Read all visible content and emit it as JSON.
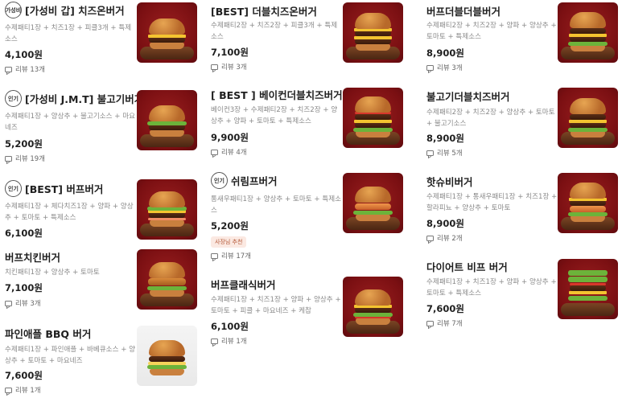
{
  "review_prefix": "리뷰",
  "columns": [
    {
      "items": [
        {
          "badge": "가성비",
          "name": "[가성비 갑] 치즈온버거",
          "desc": [
            "수제패티1장 + 치즈1장 + 피클3개 + 특제",
            "소스"
          ],
          "price": "4,100원",
          "review": "리뷰 13개",
          "image": "cheeseburger-single"
        },
        {
          "badge": "인기",
          "name": "[가성비 J.M.T] 불고기버거",
          "desc": [
            "수제패티1장 + 양상추 + 불고기소스 + 마요",
            "네즈"
          ],
          "price": "5,200원",
          "review": "리뷰 19개",
          "image": "bulgogi-burger"
        },
        {
          "badge": "인기",
          "name": "[BEST] 버프버거",
          "desc": [
            "수제패티1장 + 체다치즈1장 + 양파 + 양상",
            "추 + 토마토 + 특제소스"
          ],
          "price": "6,100원",
          "review": "",
          "image": "buff-burger"
        },
        {
          "badge": "",
          "name": "버프치킨버거",
          "desc": [
            "치킨패티1장 + 양상추 + 토마토"
          ],
          "price": "7,100원",
          "review": "리뷰 3개",
          "image": "chicken-burger"
        },
        {
          "badge": "",
          "name": "파인애플 BBQ 버거",
          "desc": [
            "수제패티1장 + 파인애플 + 바베큐소스 + 양",
            "상추 + 토마토 + 마요네즈"
          ],
          "price": "7,600원",
          "review": "리뷰 1개",
          "image": "pineapple-bbq-burger"
        }
      ]
    },
    {
      "items": [
        {
          "badge": "",
          "name": "[BEST] 더블치즈온버거",
          "desc": [
            "수제패티2장 + 치즈2장 + 피클3개 + 특제",
            "소스"
          ],
          "price": "7,100원",
          "review": "리뷰 3개",
          "image": "double-cheeseburger"
        },
        {
          "badge": "",
          "name": "[ BEST ] 베이컨더블치즈버거",
          "desc": [
            "베이컨3장 + 수제패티2장 + 치즈2장 + 양",
            "상추 + 양파 + 토마토 + 특제소스"
          ],
          "price": "9,900원",
          "review": "리뷰 4개",
          "image": "bacon-double-cheeseburger"
        },
        {
          "badge": "인기",
          "name": "쉬림프버거",
          "desc": [
            "통새우패티1장 + 양상추 + 토마토 + 특제소",
            "스"
          ],
          "price": "5,200원",
          "tag": "사장님 추천",
          "review": "리뷰 17개",
          "image": "shrimp-burger"
        },
        {
          "badge": "",
          "name": "버프클래식버거",
          "desc": [
            "수제패티1장 + 치즈1장 + 양파 + 양상추 +",
            "토마토 + 피클 + 마요네즈 + 케찹"
          ],
          "price": "6,100원",
          "review": "리뷰 1개",
          "image": "classic-burger"
        }
      ]
    },
    {
      "items": [
        {
          "badge": "",
          "name": "버프더블더블버거",
          "desc": [
            "수제패티2장 + 치즈2장 + 양파 + 양상추 +",
            "토마토 + 특제소스"
          ],
          "price": "8,900원",
          "review": "리뷰 3개",
          "image": "double-double-burger"
        },
        {
          "badge": "",
          "name": "불고기더블치즈버거",
          "desc": [
            "수제패티2장 + 치즈2장 + 양상추 + 토마토",
            "+ 불고기소스"
          ],
          "price": "8,900원",
          "review": "리뷰 5개",
          "image": "bulgogi-double-cheeseburger"
        },
        {
          "badge": "",
          "name": "핫슈비버거",
          "desc": [
            "수제패티1장 + 통새우패티1장 + 치즈1장 +",
            "할라피뇨 + 양상추 + 토마토"
          ],
          "price": "8,900원",
          "review": "리뷰 2개",
          "image": "hot-shubi-burger"
        },
        {
          "badge": "",
          "name": "다이어트 비프 버거",
          "desc": [
            "수제패티1장 + 치즈1장 + 양파 + 양상추 +",
            "토마토 + 특제소스"
          ],
          "price": "7,600원",
          "review": "리뷰 7개",
          "image": "diet-beef-burger"
        }
      ]
    }
  ]
}
